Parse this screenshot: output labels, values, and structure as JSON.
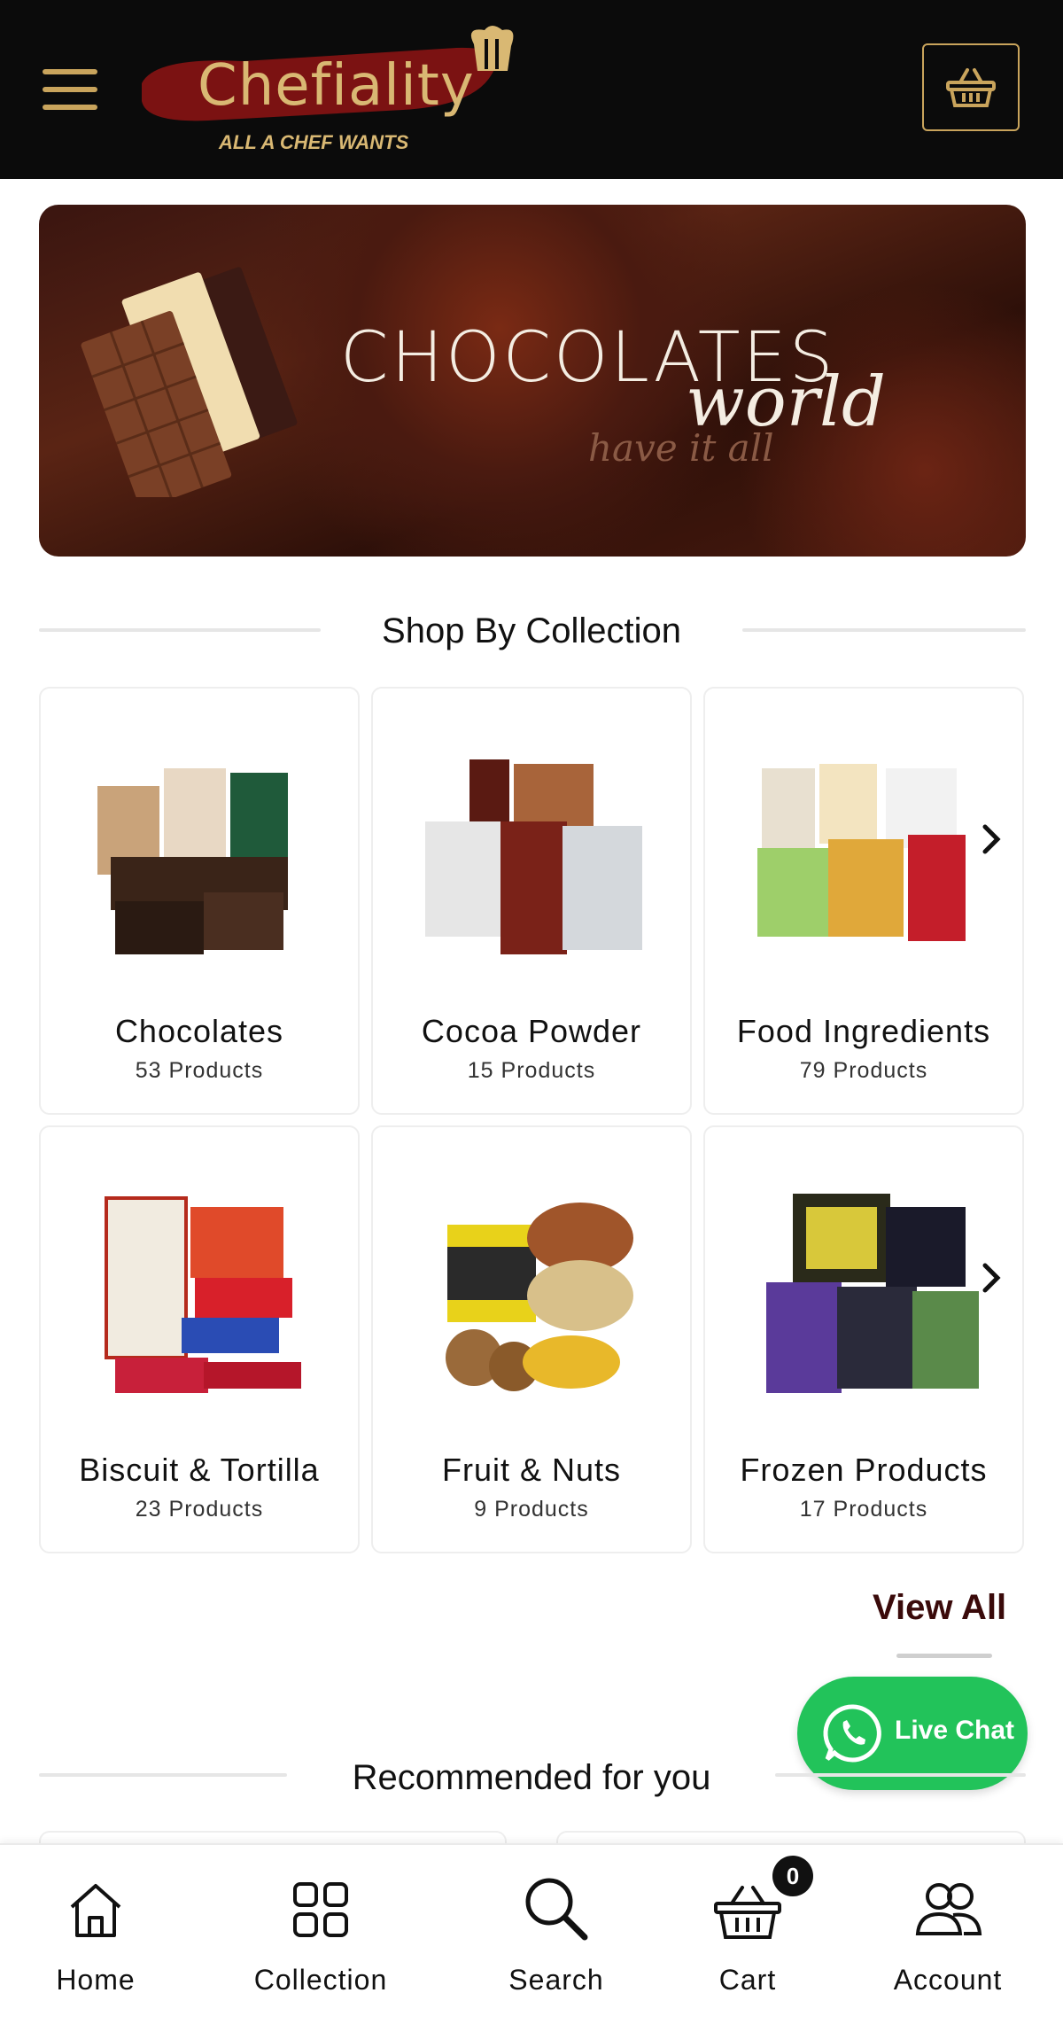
{
  "header": {
    "brand": "Chefiality",
    "tagline": "ALL A CHEF WANTS",
    "accent_color": "#c9a45c",
    "menu_icon": "hamburger-menu-icon",
    "cart_icon": "basket-icon"
  },
  "banner": {
    "title": "CHOCOLATES",
    "subtitle": "world",
    "tagline": "have it all"
  },
  "collections_section": {
    "title": "Shop By Collection",
    "view_all_label": "View All",
    "items": [
      {
        "name": "Chocolates",
        "count": "53 Products"
      },
      {
        "name": "Cocoa Powder",
        "count": "15 Products"
      },
      {
        "name": "Food Ingredients",
        "count": "79 Products"
      },
      {
        "name": "Biscuit & Tortilla",
        "count": "23 Products"
      },
      {
        "name": "Fruit & Nuts",
        "count": "9 Products"
      },
      {
        "name": "Frozen Products",
        "count": "17 Products"
      }
    ]
  },
  "recommended_section": {
    "title": "Recommended for you"
  },
  "live_chat": {
    "label": "Live Chat",
    "icon": "whatsapp-icon",
    "color": "#22c35a"
  },
  "bottom_nav": {
    "items": [
      {
        "label": "Home",
        "icon": "home-icon"
      },
      {
        "label": "Collection",
        "icon": "grid-icon"
      },
      {
        "label": "Search",
        "icon": "search-icon"
      },
      {
        "label": "Cart",
        "icon": "cart-icon"
      },
      {
        "label": "Account",
        "icon": "users-icon"
      }
    ],
    "cart_badge": "0"
  }
}
